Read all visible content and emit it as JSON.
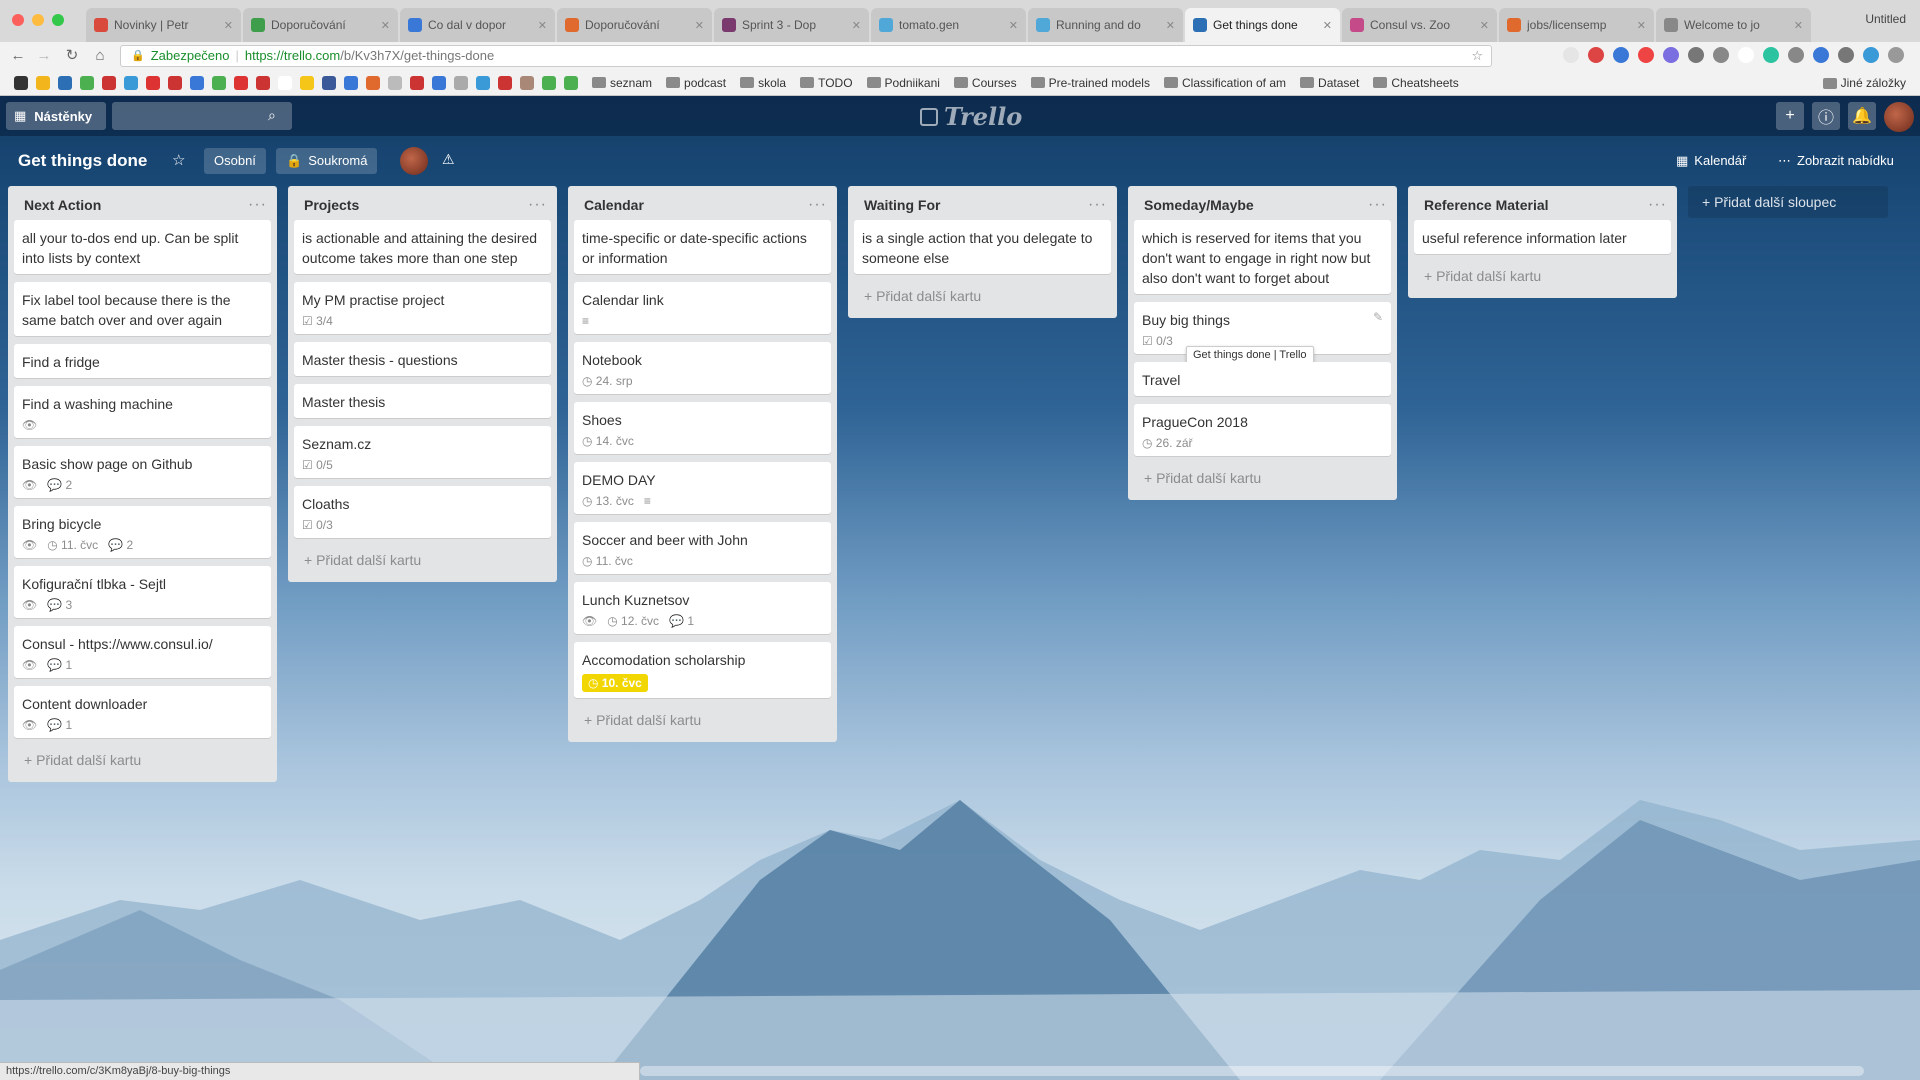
{
  "browser": {
    "tabs": [
      {
        "label": "Novinky | Petr",
        "color": "#d94a3d",
        "active": false
      },
      {
        "label": "Doporučování",
        "color": "#3f9e4b",
        "active": false
      },
      {
        "label": "Co dal v dopor",
        "color": "#3a78d8",
        "active": false
      },
      {
        "label": "Doporučování",
        "color": "#e0692e",
        "active": false
      },
      {
        "label": "Sprint 3 - Dop",
        "color": "#7a3a6e",
        "active": false
      },
      {
        "label": "tomato.gen",
        "color": "#4fa8d8",
        "active": false
      },
      {
        "label": "Running and do",
        "color": "#4fa8d8",
        "active": false
      },
      {
        "label": "Get things done",
        "color": "#2d6fb5",
        "active": true
      },
      {
        "label": "Consul vs. Zoo",
        "color": "#c44a8a",
        "active": false
      },
      {
        "label": "jobs/licensemp",
        "color": "#e0692e",
        "active": false
      },
      {
        "label": "Welcome to jo",
        "color": "#888888",
        "active": false
      }
    ],
    "window_user": "Untitled",
    "secure_label": "Zabezpečeno",
    "url_host": "https://trello.com",
    "url_path": "/b/Kv3h7X/get-things-done",
    "bookmarks": [
      "seznam",
      "podcast",
      "skola",
      "TODO",
      "Podniikani",
      "Courses",
      "Pre-trained models",
      "Classification of am",
      "Dataset",
      "Cheatsheets"
    ],
    "bookmarks_other": "Jiné záložky",
    "status_url": "https://trello.com/c/3Km8yaBj/8-buy-big-things"
  },
  "header": {
    "boards_label": "Nástěnky",
    "search_placeholder": "",
    "logo": "Trello"
  },
  "board": {
    "title": "Get things done",
    "team_label": "Osobní",
    "visibility_label": "Soukromá",
    "calendar_label": "Kalendář",
    "menu_label": "Zobrazit nabídku",
    "add_list_label": "+ Přidat další sloupec"
  },
  "add_card_label": "+ Přidat další kartu",
  "lists": [
    {
      "title": "Next Action",
      "cards": [
        {
          "text": "all your to-dos end up. Can be split into lists by context",
          "badges": []
        },
        {
          "text": "Fix label tool because there is the same batch over and over again",
          "badges": []
        },
        {
          "text": "Find a fridge",
          "badges": []
        },
        {
          "text": "Find a washing machine",
          "badges": [
            "👁"
          ]
        },
        {
          "text": "Basic show page on Github",
          "badges": [
            "👁",
            "💬 2"
          ]
        },
        {
          "text": "Bring bicycle",
          "badges": [
            "👁",
            "◷ 11. čvc",
            "💬 2"
          ]
        },
        {
          "text": "Kofigurační tlbka - Sejtl",
          "badges": [
            "👁",
            "💬 3"
          ]
        },
        {
          "text": "Consul - https://www.consul.io/",
          "badges": [
            "👁",
            "💬 1"
          ]
        },
        {
          "text": "Content downloader",
          "badges": [
            "👁",
            "💬 1"
          ]
        }
      ]
    },
    {
      "title": "Projects",
      "cards": [
        {
          "text": "is actionable and attaining the desired outcome takes more than one step",
          "badges": []
        },
        {
          "text": "My PM practise project",
          "badges": [
            "☑ 3/4"
          ]
        },
        {
          "text": "Master thesis - questions",
          "badges": []
        },
        {
          "text": "Master thesis",
          "badges": []
        },
        {
          "text": "Seznam.cz",
          "badges": [
            "☑ 0/5"
          ]
        },
        {
          "text": "Cloaths",
          "badges": [
            "☑ 0/3"
          ]
        }
      ]
    },
    {
      "title": "Calendar",
      "cards": [
        {
          "text": "time-specific or date-specific actions or information",
          "badges": []
        },
        {
          "text": "Calendar link",
          "badges": [
            "≡"
          ]
        },
        {
          "text": "Notebook",
          "badges": [
            "◷ 24. srp"
          ]
        },
        {
          "text": "Shoes",
          "badges": [
            "◷ 14. čvc"
          ]
        },
        {
          "text": "DEMO DAY",
          "badges": [
            "◷ 13. čvc",
            "≡"
          ]
        },
        {
          "text": "Soccer and beer with John",
          "badges": [
            "◷ 11. čvc"
          ]
        },
        {
          "text": "Lunch Kuznetsov",
          "badges": [
            "👁",
            "◷ 12. čvc",
            "💬 1"
          ]
        },
        {
          "text": "Accomodation scholarship",
          "due": "◷ 10. čvc",
          "badges": []
        }
      ]
    },
    {
      "title": "Waiting For",
      "cards": [
        {
          "text": "is a single action that you delegate to someone else",
          "badges": []
        }
      ]
    },
    {
      "title": "Someday/Maybe",
      "cards": [
        {
          "text": "which is reserved for items that you don't want to engage in right now but also don't want to forget about",
          "badges": []
        },
        {
          "text": "Buy big things",
          "badges": [
            "☑ 0/3"
          ],
          "tooltip": "Get things done | Trello"
        },
        {
          "text": "Travel",
          "badges": []
        },
        {
          "text": "PragueCon 2018",
          "badges": [
            "◷ 26. zář"
          ]
        }
      ]
    },
    {
      "title": "Reference Material",
      "cards": [
        {
          "text": "useful reference information later",
          "badges": []
        }
      ]
    }
  ]
}
